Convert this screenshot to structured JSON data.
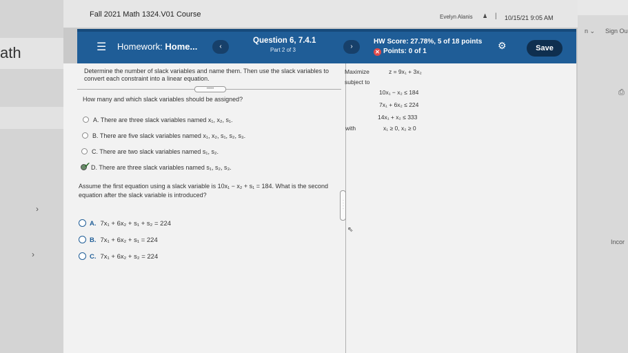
{
  "browser": {
    "left_text": "ath",
    "right_top": "Sign Ou",
    "right_mid": "Incor",
    "right_small": "n ⌄"
  },
  "topbar": {
    "course": "Fall 2021 Math 1324.V01 Course",
    "user": "Evelyn Alanis",
    "datetime": "10/15/21 9:05 AM"
  },
  "header": {
    "title_prefix": "Homework:",
    "title_main": "Home...",
    "question": "Question 6, 7.4.1",
    "part": "Part 2 of 3",
    "hw_score": "HW Score: 27.78%, 5 of 18 points",
    "points": "Points: 0 of 1",
    "save_label": "Save",
    "prev_label": "‹",
    "next_label": "›"
  },
  "left": {
    "instructions": "Determine the number of slack variables and name them. Then use the slack variables to convert each constraint into a linear equation.",
    "question1": "How many and which slack variables should be assigned?",
    "options1": [
      {
        "letter": "A.",
        "text": "There are three slack variables named x₁, x₂, s₁."
      },
      {
        "letter": "B.",
        "text": "There are five slack variables named x₁, x₂, s₁, s₂, s₃."
      },
      {
        "letter": "C.",
        "text": "There are two slack variables named s₁, s₂."
      },
      {
        "letter": "D.",
        "text": "There are three slack variables named s₁, s₂, s₃."
      }
    ],
    "question2": "Assume the first equation using a slack variable is 10x₁ − x₂ + s₁ = 184. What is the second equation after the slack variable is introduced?",
    "options2": [
      {
        "letter": "A.",
        "text": "7x₁ + 6x₂ + s₁ + s₂ = 224"
      },
      {
        "letter": "B.",
        "text": "7x₁ + 6x₂ + s₁ = 224"
      },
      {
        "letter": "C.",
        "text": "7x₁ + 6x₂ + s₂ = 224"
      }
    ]
  },
  "right": {
    "maximize_label": "Maximize",
    "objective": "z = 9x₁ + 3x₂",
    "subject_to": "subject to",
    "constraints": [
      "10x₁ − x₂ ≤ 184",
      "7x₁ + 6x₂ ≤ 224",
      "14x₁ + x₂ ≤ 333"
    ],
    "with_label": "with",
    "nonneg": "x₁ ≥ 0,   x₂ ≥ 0"
  }
}
